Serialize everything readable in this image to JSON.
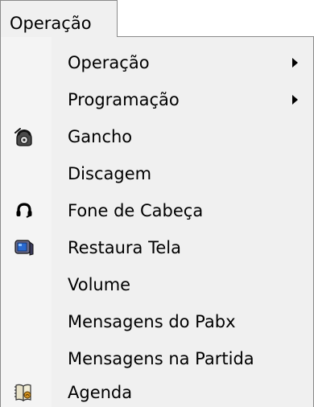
{
  "menubar": {
    "active_menu": "Operação"
  },
  "menu": {
    "items": [
      {
        "label": "Operação",
        "icon": "",
        "submenu": true
      },
      {
        "label": "Programação",
        "icon": "",
        "submenu": true
      },
      {
        "label": "Gancho",
        "icon": "telephone-icon",
        "submenu": false
      },
      {
        "label": "Discagem",
        "icon": "",
        "submenu": false
      },
      {
        "label": "Fone de Cabeça",
        "icon": "headset-icon",
        "submenu": false
      },
      {
        "label": "Restaura Tela",
        "icon": "monitor-icon",
        "submenu": false
      },
      {
        "label": "Volume",
        "icon": "",
        "submenu": false
      },
      {
        "label": "Mensagens do Pabx",
        "icon": "",
        "submenu": false
      },
      {
        "label": "Mensagens na Partida",
        "icon": "",
        "submenu": false
      },
      {
        "label": "Agenda",
        "icon": "address-book-icon",
        "submenu": false
      }
    ]
  }
}
